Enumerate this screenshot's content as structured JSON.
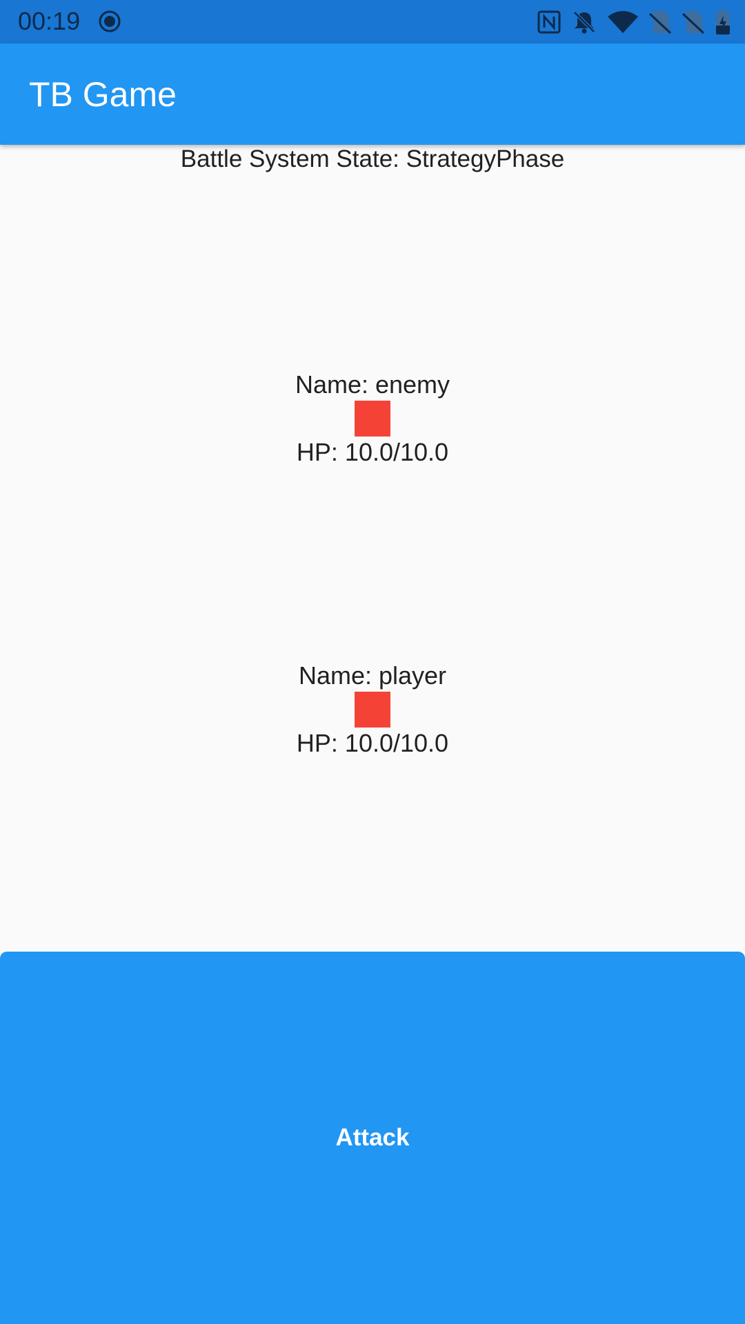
{
  "status_bar": {
    "time": "00:19",
    "icons": [
      "record-icon",
      "nfc-icon",
      "notifications-off-icon",
      "wifi-icon",
      "no-sim-icon",
      "no-sim-icon",
      "battery-charging-icon"
    ]
  },
  "app_bar": {
    "title": "TB Game"
  },
  "battle": {
    "state_text": "Battle System State: StrategyPhase"
  },
  "enemy": {
    "name_text": "Name: enemy",
    "hp_text": "HP: 10.0/10.0",
    "sprite_color": "#f44336"
  },
  "player": {
    "name_text": "Name: player",
    "hp_text": "HP: 10.0/10.0",
    "sprite_color": "#f44336"
  },
  "actions": {
    "attack_label": "Attack"
  },
  "colors": {
    "primary": "#2196f3",
    "status_bar": "#1976d2",
    "background": "#fafafa",
    "sprite": "#f44336"
  }
}
